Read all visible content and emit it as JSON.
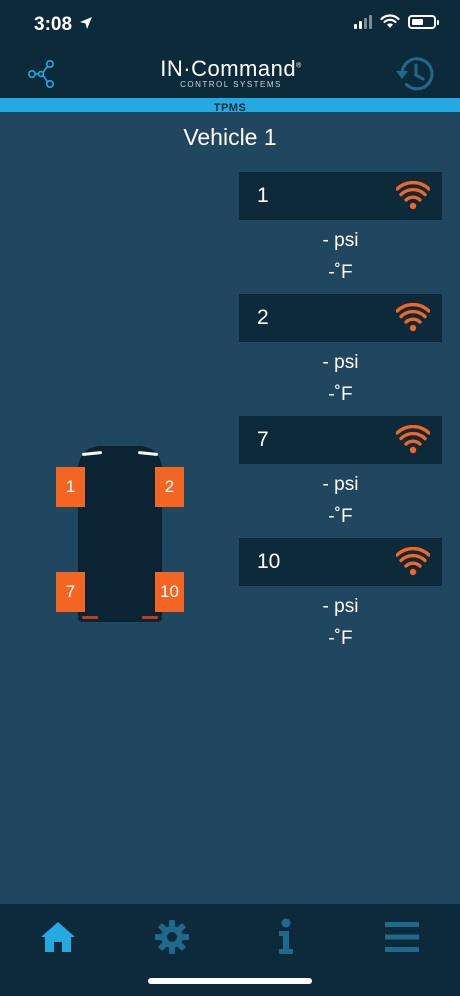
{
  "status_bar": {
    "time": "3:08",
    "icons": [
      "location-arrow-icon",
      "cellular-signal-icon",
      "wifi-icon",
      "battery-icon"
    ]
  },
  "header": {
    "brand_main": "IN·Command",
    "brand_registered": "®",
    "brand_sub": "CONTROL SYSTEMS",
    "left_icon": "network-icon",
    "right_icon": "history-icon"
  },
  "section_bar": {
    "label": "TPMS"
  },
  "vehicle": {
    "title": "Vehicle 1",
    "tire_positions": [
      "1",
      "2",
      "7",
      "10"
    ]
  },
  "sensors": [
    {
      "id": "1",
      "pressure": "- psi",
      "temperature": "-˚F",
      "signal_icon": "wifi-signal-icon"
    },
    {
      "id": "2",
      "pressure": "- psi",
      "temperature": "-˚F",
      "signal_icon": "wifi-signal-icon"
    },
    {
      "id": "7",
      "pressure": "- psi",
      "temperature": "-˚F",
      "signal_icon": "wifi-signal-icon"
    },
    {
      "id": "10",
      "pressure": "- psi",
      "temperature": "-˚F",
      "signal_icon": "wifi-signal-icon"
    }
  ],
  "bottom_nav": {
    "items": [
      "home-icon",
      "settings-gear-icon",
      "info-icon",
      "menu-icon"
    ],
    "active": "home-icon"
  },
  "colors": {
    "background": "#21465f",
    "header": "#0d2a3b",
    "accent_blue": "#24a9e1",
    "tire_orange": "#f26522",
    "inactive_nav": "#1f6a8a"
  }
}
